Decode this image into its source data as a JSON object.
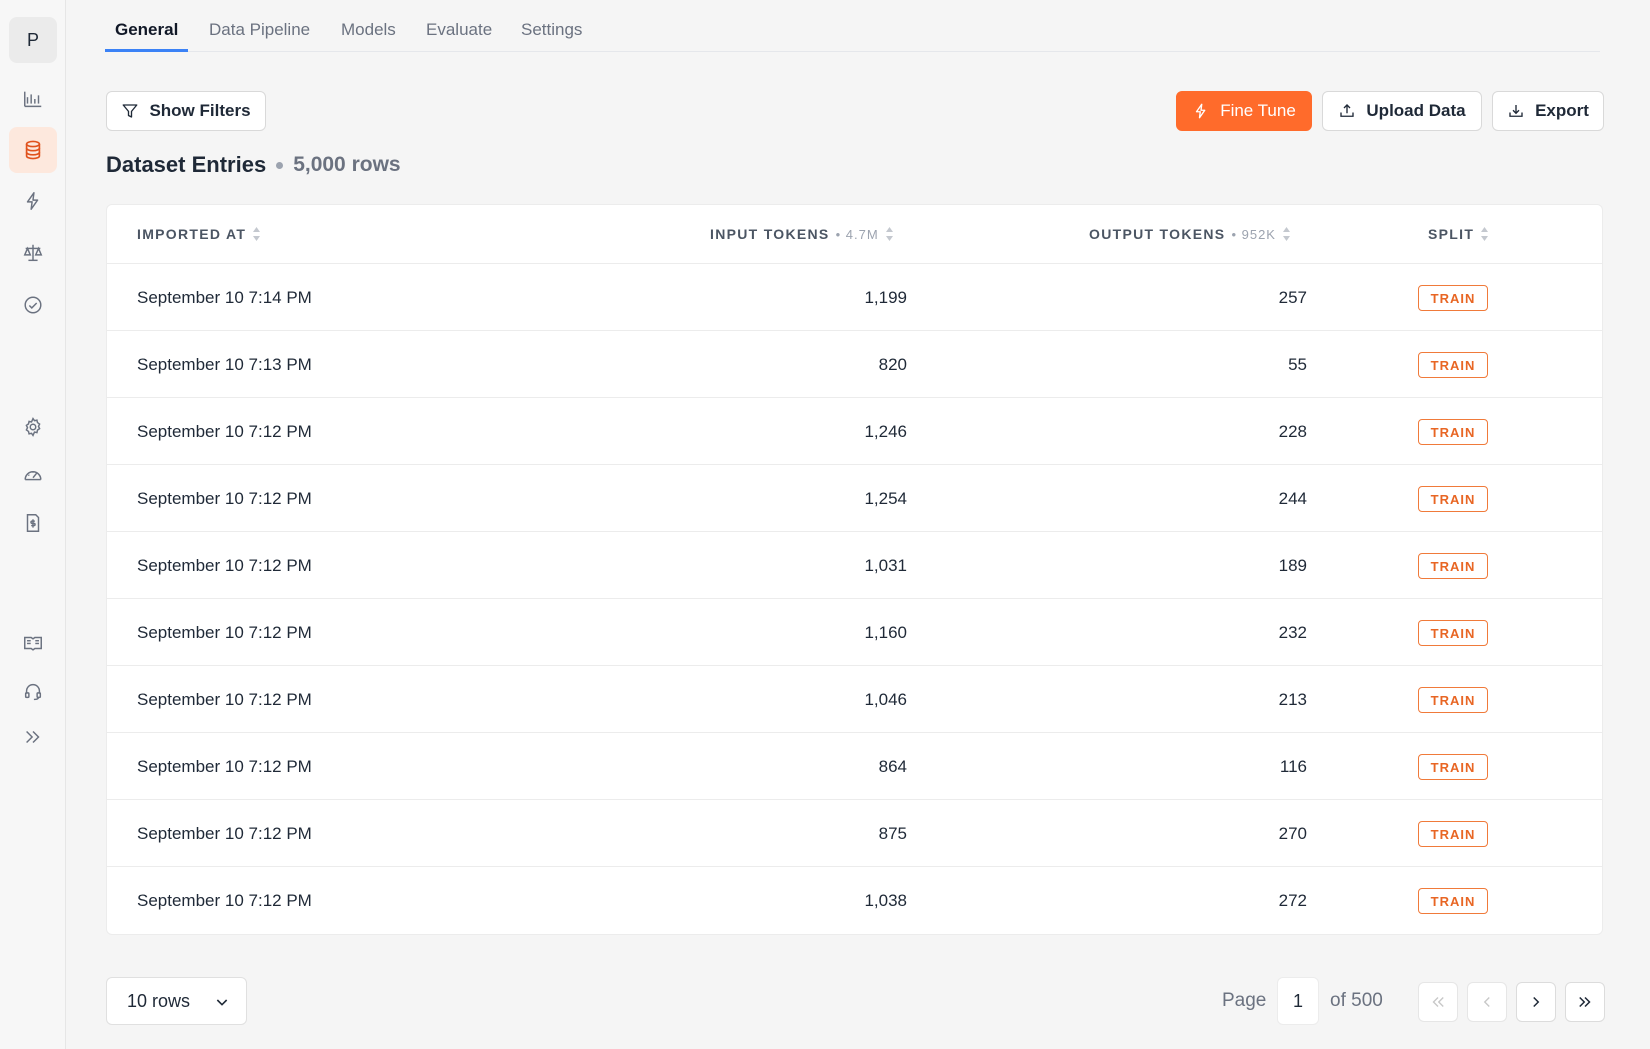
{
  "sidebar": {
    "avatar_letter": "P",
    "items": [
      {
        "name": "analytics",
        "icon": "bar-chart-icon",
        "active": false
      },
      {
        "name": "datasets",
        "icon": "database-icon",
        "active": true
      },
      {
        "name": "fine-tunes",
        "icon": "bolt-icon",
        "active": false
      },
      {
        "name": "evals",
        "icon": "scale-icon",
        "active": false
      },
      {
        "name": "tests",
        "icon": "check-circle-icon",
        "active": false
      },
      {
        "name": "settings",
        "icon": "gear-icon",
        "active": false
      },
      {
        "name": "usage",
        "icon": "gauge-icon",
        "active": false
      },
      {
        "name": "billing",
        "icon": "invoice-icon",
        "active": false
      },
      {
        "name": "docs",
        "icon": "book-icon",
        "active": false
      },
      {
        "name": "support",
        "icon": "headset-icon",
        "active": false
      },
      {
        "name": "expand",
        "icon": "double-chevron-right-icon",
        "active": false
      }
    ]
  },
  "tabs": [
    "General",
    "Data Pipeline",
    "Models",
    "Evaluate",
    "Settings"
  ],
  "toolbar": {
    "show_filters": "Show Filters",
    "fine_tune": "Fine Tune",
    "upload_data": "Upload Data",
    "export": "Export",
    "accent_color": "#ff6b2b"
  },
  "heading": {
    "title": "Dataset Entries",
    "row_count": "5,000 rows"
  },
  "table": {
    "columns": {
      "imported_at": "IMPORTED AT",
      "input_tokens": "INPUT TOKENS",
      "input_tokens_total": "4.7M",
      "output_tokens": "OUTPUT TOKENS",
      "output_tokens_total": "952K",
      "split": "SPLIT"
    },
    "rows": [
      {
        "imported_at": "September 10 7:14 PM",
        "input": "1,199",
        "output": "257",
        "split": "TRAIN"
      },
      {
        "imported_at": "September 10 7:13 PM",
        "input": "820",
        "output": "55",
        "split": "TRAIN"
      },
      {
        "imported_at": "September 10 7:12 PM",
        "input": "1,246",
        "output": "228",
        "split": "TRAIN"
      },
      {
        "imported_at": "September 10 7:12 PM",
        "input": "1,254",
        "output": "244",
        "split": "TRAIN"
      },
      {
        "imported_at": "September 10 7:12 PM",
        "input": "1,031",
        "output": "189",
        "split": "TRAIN"
      },
      {
        "imported_at": "September 10 7:12 PM",
        "input": "1,160",
        "output": "232",
        "split": "TRAIN"
      },
      {
        "imported_at": "September 10 7:12 PM",
        "input": "1,046",
        "output": "213",
        "split": "TRAIN"
      },
      {
        "imported_at": "September 10 7:12 PM",
        "input": "864",
        "output": "116",
        "split": "TRAIN"
      },
      {
        "imported_at": "September 10 7:12 PM",
        "input": "875",
        "output": "270",
        "split": "TRAIN"
      },
      {
        "imported_at": "September 10 7:12 PM",
        "input": "1,038",
        "output": "272",
        "split": "TRAIN"
      }
    ]
  },
  "pagination": {
    "rows_per_page": "10 rows",
    "page_label": "Page",
    "current_page": "1",
    "of_label": "of 500"
  }
}
